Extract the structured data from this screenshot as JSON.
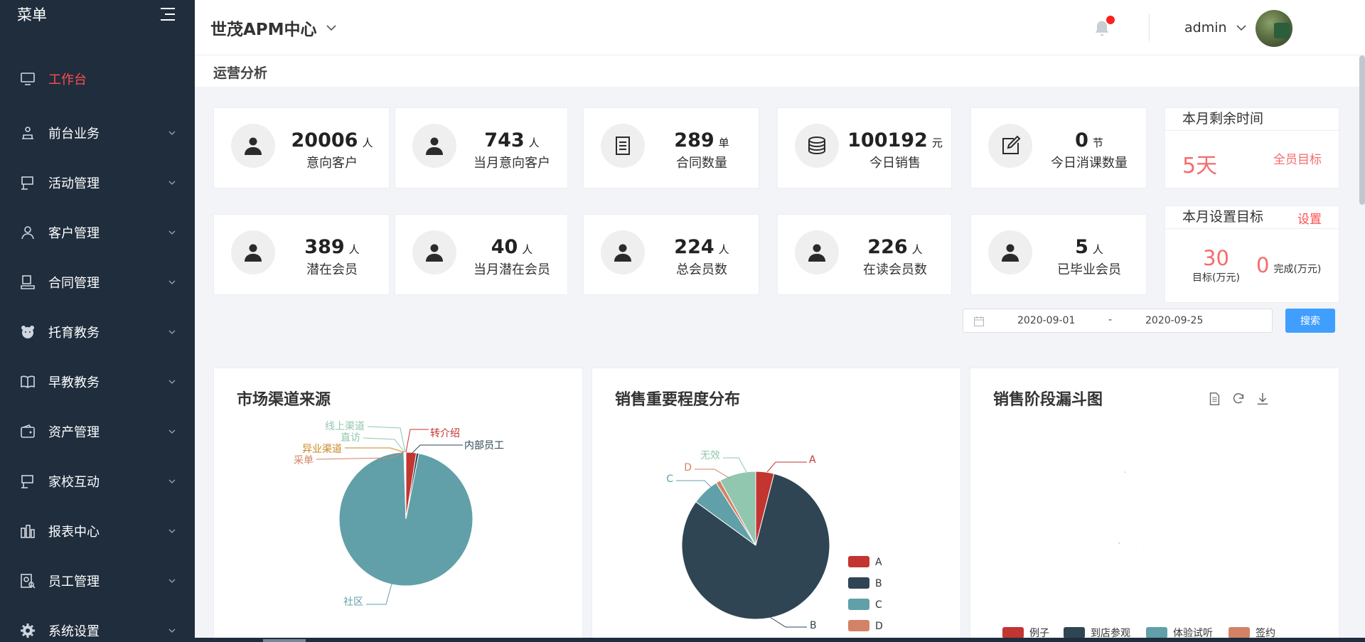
{
  "sidebar": {
    "title": "菜单",
    "items": [
      {
        "label": "工作台",
        "icon": "monitor-icon",
        "active": true
      },
      {
        "label": "前台业务",
        "icon": "reception-icon"
      },
      {
        "label": "活动管理",
        "icon": "board-icon"
      },
      {
        "label": "客户管理",
        "icon": "user-icon"
      },
      {
        "label": "合同管理",
        "icon": "stamp-icon"
      },
      {
        "label": "托育教务",
        "icon": "bear-icon"
      },
      {
        "label": "早教教务",
        "icon": "book-icon"
      },
      {
        "label": "资产管理",
        "icon": "wallet-icon"
      },
      {
        "label": "家校互动",
        "icon": "board-icon"
      },
      {
        "label": "报表中心",
        "icon": "report-icon"
      },
      {
        "label": "员工管理",
        "icon": "staff-icon"
      },
      {
        "label": "系统设置",
        "icon": "gear-icon"
      }
    ]
  },
  "header": {
    "brand": "世茂APM中心",
    "user": "admin"
  },
  "section_title": "运营分析",
  "stats_row1": [
    {
      "value": "20006",
      "unit": "人",
      "label": "意向客户",
      "icon": "person-icon"
    },
    {
      "value": "743",
      "unit": "人",
      "label": "当月意向客户",
      "icon": "person-icon"
    },
    {
      "value": "289",
      "unit": "单",
      "label": "合同数量",
      "icon": "document-icon"
    },
    {
      "value": "100192",
      "unit": "元",
      "label": "今日销售",
      "icon": "coins-icon"
    },
    {
      "value": "0",
      "unit": "节",
      "label": "今日消课数量",
      "icon": "edit-icon"
    }
  ],
  "stats_row2": [
    {
      "value": "389",
      "unit": "人",
      "label": "潜在会员",
      "icon": "person-icon"
    },
    {
      "value": "40",
      "unit": "人",
      "label": "当月潜在会员",
      "icon": "person-icon"
    },
    {
      "value": "224",
      "unit": "人",
      "label": "总会员数",
      "icon": "person-icon"
    },
    {
      "value": "226",
      "unit": "人",
      "label": "在读会员数",
      "icon": "person-icon"
    },
    {
      "value": "5",
      "unit": "人",
      "label": "已毕业会员",
      "icon": "person-icon"
    }
  ],
  "remaining": {
    "title": "本月剩余时间",
    "value": "5天",
    "link": "全员目标"
  },
  "target": {
    "title": "本月设置目标",
    "link": "设置",
    "target_value": "30",
    "target_label": "目标(万元)",
    "done_value": "0",
    "done_label": "完成(万元)"
  },
  "filter": {
    "start": "2020-09-01",
    "separator": "-",
    "end": "2020-09-25",
    "search": "搜索"
  },
  "colors": {
    "red": "#c23531",
    "navy": "#2f4554",
    "teal": "#61a0a8",
    "orange": "#d48265",
    "green": "#91c7ae",
    "gold": "#ca8622",
    "accent": "#ff4d4f",
    "blue": "#409eff"
  },
  "chart_data": [
    {
      "type": "pie",
      "title": "市场渠道来源",
      "slices": [
        {
          "name": "转介绍",
          "value": 2.5,
          "color": "#c23531"
        },
        {
          "name": "内部员工",
          "value": 0.6,
          "color": "#2f4554"
        },
        {
          "name": "社区",
          "value": 96.4,
          "color": "#61a0a8"
        },
        {
          "name": "采单",
          "value": 0.1,
          "color": "#d48265"
        },
        {
          "name": "异业渠道",
          "value": 0.1,
          "color": "#ca8622"
        },
        {
          "name": "直访",
          "value": 0.15,
          "color": "#91c7ae"
        },
        {
          "name": "线上渠道",
          "value": 0.15,
          "color": "#91c7ae"
        }
      ]
    },
    {
      "type": "pie",
      "title": "销售重要程度分布",
      "slices": [
        {
          "name": "A",
          "value": 4,
          "color": "#c23531"
        },
        {
          "name": "B",
          "value": 81,
          "color": "#2f4554"
        },
        {
          "name": "C",
          "value": 6,
          "color": "#61a0a8"
        },
        {
          "name": "D",
          "value": 1,
          "color": "#d48265"
        },
        {
          "name": "无效",
          "value": 8,
          "color": "#91c7ae"
        }
      ],
      "legend": [
        "A",
        "B",
        "C",
        "D"
      ]
    },
    {
      "type": "funnel",
      "title": "销售阶段漏斗图",
      "stages": [
        {
          "name": "例子",
          "color": "#c23531"
        },
        {
          "name": "到店参观",
          "color": "#2f4554"
        },
        {
          "name": "体验试听",
          "color": "#61a0a8"
        },
        {
          "name": "签约",
          "color": "#d48265"
        }
      ],
      "legend": [
        "例子",
        "到店参观",
        "体验试听",
        "签约"
      ]
    }
  ]
}
